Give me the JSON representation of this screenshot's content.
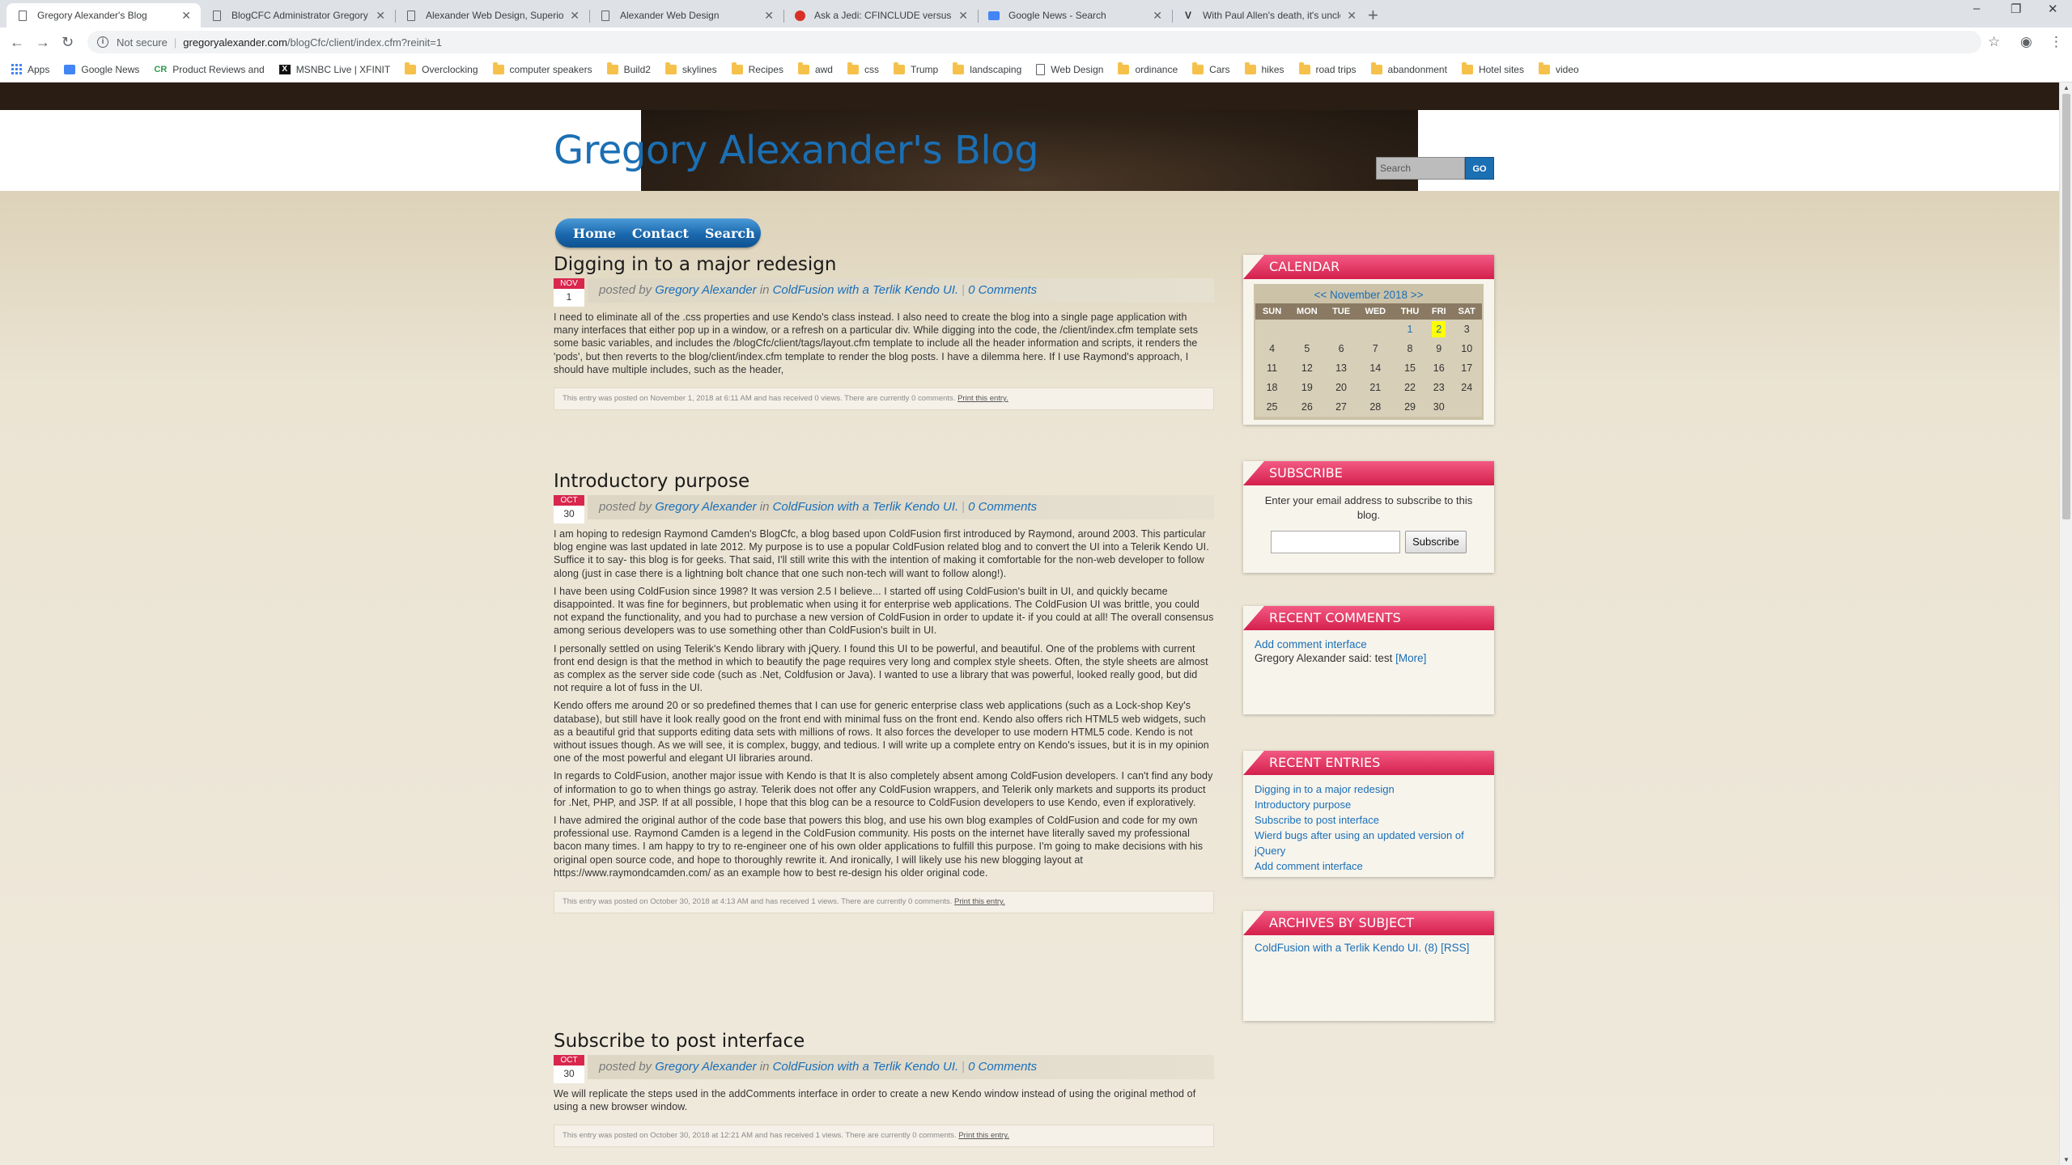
{
  "browser": {
    "tabs": [
      {
        "title": "Gregory Alexander's Blog",
        "icon": "page-icon",
        "active": true
      },
      {
        "title": "BlogCFC Administrator Gregory A",
        "icon": "page-icon"
      },
      {
        "title": "Alexander Web Design, Superior",
        "icon": "page-icon"
      },
      {
        "title": "Alexander Web Design",
        "icon": "page-icon"
      },
      {
        "title": "Ask a Jedi: CFINCLUDE versus CF",
        "icon": "red-circle-icon"
      },
      {
        "title": "Google News - Search",
        "icon": "google-news-icon"
      },
      {
        "title": "With Paul Allen's death, it's uncle",
        "icon": "verge-icon"
      }
    ],
    "new_tab": "+",
    "window_controls": {
      "minimize": "–",
      "restore": "❐",
      "close": "✕"
    },
    "nav": {
      "back": "←",
      "forward": "→",
      "reload": "↻"
    },
    "address": {
      "security": "Not secure",
      "host": "gregoryalexander.com",
      "path": "/blogCfc/client/index.cfm?reinit=1"
    },
    "toolbar_icons": {
      "star": "☆",
      "account": "◉",
      "menu": "⋮"
    },
    "bookmarks": [
      {
        "label": "Apps",
        "icon": "apps-grid-icon"
      },
      {
        "label": "Google News",
        "icon": "google-news-icon"
      },
      {
        "label": "Product Reviews and",
        "icon": "cr-icon"
      },
      {
        "label": "MSNBC Live | XFINIT",
        "icon": "x-icon"
      },
      {
        "label": "Overclocking",
        "icon": "folder-icon"
      },
      {
        "label": "computer speakers",
        "icon": "folder-icon"
      },
      {
        "label": "Build2",
        "icon": "folder-icon"
      },
      {
        "label": "skylines",
        "icon": "folder-icon"
      },
      {
        "label": "Recipes",
        "icon": "folder-icon"
      },
      {
        "label": "awd",
        "icon": "folder-icon"
      },
      {
        "label": "css",
        "icon": "folder-icon"
      },
      {
        "label": "Trump",
        "icon": "folder-icon"
      },
      {
        "label": "landscaping",
        "icon": "folder-icon"
      },
      {
        "label": "Web Design",
        "icon": "page-icon"
      },
      {
        "label": "ordinance",
        "icon": "folder-icon"
      },
      {
        "label": "Cars",
        "icon": "folder-icon"
      },
      {
        "label": "hikes",
        "icon": "folder-icon"
      },
      {
        "label": "road trips",
        "icon": "folder-icon"
      },
      {
        "label": "abandonment",
        "icon": "folder-icon"
      },
      {
        "label": "Hotel sites",
        "icon": "folder-icon"
      },
      {
        "label": "video",
        "icon": "folder-icon"
      }
    ]
  },
  "blog": {
    "title": "Gregory Alexander's Blog",
    "search_placeholder": "Search",
    "search_button": "GO",
    "menu": [
      "Home",
      "Contact",
      "Search"
    ],
    "colors": {
      "accent_blue": "#1b6fb3",
      "widget_red": "#d41f4c",
      "calendar_today": "#ffff00"
    }
  },
  "posts": [
    {
      "title": "Digging in to a major redesign",
      "month": "NOV",
      "day": "1",
      "posted_by": "posted by",
      "author": "Gregory Alexander",
      "in": "in",
      "category": "ColdFusion with a Terlik Kendo UI.",
      "comments": "0 Comments",
      "paragraphs": [
        "I need to eliminate all of the .css properties and use Kendo's class instead. I also need to create the blog into a single page application with many interfaces that either pop up in a window, or a refresh on a particular div. While digging into the code, the /client/index.cfm template sets some basic variables, and includes the /blogCfc/client/tags/layout.cfm template to include all the header information and scripts, it renders the 'pods', but then reverts to the blog/client/index.cfm template to render the blog posts. I have a dilemma here. If I use Raymond's approach, I should have multiple includes, such as the header,"
      ],
      "footer": "This entry was posted on November 1, 2018 at 6:11 AM and has received 0 views. There are currently 0 comments.",
      "print": "Print this entry."
    },
    {
      "title": "Introductory purpose",
      "month": "OCT",
      "day": "30",
      "posted_by": "posted by",
      "author": "Gregory Alexander",
      "in": "in",
      "category": "ColdFusion with a Terlik Kendo UI.",
      "comments": "0 Comments",
      "paragraphs": [
        "I am hoping to redesign Raymond Camden's BlogCfc, a blog based upon ColdFusion first introduced by Raymond, around 2003. This particular blog engine was last updated in late 2012. My purpose is to use a popular ColdFusion related blog and to convert the UI into a Telerik Kendo UI. Suffice it to say- this blog is for geeks. That said, I'll still write this with the intention of making it comfortable for the non-web developer to follow along (just in case there is a lightning bolt chance that one such non-tech will want to follow along!).",
        "I have been using ColdFusion since 1998? It was version 2.5 I believe... I started off using ColdFusion's built in UI, and quickly became disappointed. It was fine for beginners, but problematic when using it for enterprise web applications. The ColdFusion UI was brittle, you could not expand the functionality, and you had to purchase a new version of ColdFusion in order to update it- if you could at all! The overall consensus among serious developers was to use something other than ColdFusion's built in UI.",
        "I personally settled on using Telerik's Kendo library with jQuery. I found this UI to be powerful, and beautiful. One of the problems with current front end design is that the method in which to beautify the page requires very long and complex style sheets. Often, the style sheets are almost as complex as the server side code (such as .Net, Coldfusion or Java). I wanted to use a library that was powerful, looked really good, but did not require a lot of fuss in the UI.",
        "Kendo offers me around 20 or so predefined themes that I can use for generic enterprise class web applications (such as a Lock-shop Key's database), but still have it look really good on the front end with minimal fuss on the front end. Kendo also offers rich HTML5 web widgets, such as a beautiful grid that supports editing data sets with millions of rows. It also forces the developer to use modern HTML5 code. Kendo is not without issues though. As we will see, it is complex, buggy, and tedious. I will write up a complete entry on Kendo's issues, but it is in my opinion one of the most powerful and elegant UI libraries around.",
        "In regards to ColdFusion, another major issue with Kendo is that It is also completely absent among ColdFusion developers. I can't find any body of information to go to when things go astray. Telerik does not offer any ColdFusion wrappers, and Telerik only markets and supports its product for .Net, PHP, and JSP. If at all possible, I hope that this blog can be a resource to ColdFusion developers to use Kendo, even if exploratively.",
        "I have admired the original author of the code base that powers this blog, and use his own blog examples of ColdFusion and code for my own professional use. Raymond Camden is a legend in the ColdFusion community. His posts on the internet have literally saved my professional bacon many times. I am happy to try to re-engineer one of his own older applications to fulfill this purpose. I'm going to make decisions with his original open source code, and hope to thoroughly rewrite it. And ironically, I will likely use his new blogging layout at https://www.raymondcamden.com/ as an example how to best re-design his older original code."
      ],
      "footer": "This entry was posted on October 30, 2018 at 4:13 AM and has received 1 views. There are currently 0 comments.",
      "print": "Print this entry."
    },
    {
      "title": "Subscribe to post interface",
      "month": "OCT",
      "day": "30",
      "posted_by": "posted by",
      "author": "Gregory Alexander",
      "in": "in",
      "category": "ColdFusion with a Terlik Kendo UI.",
      "comments": "0 Comments",
      "paragraphs": [
        "We will replicate the steps used in the addComments interface in order to create a new Kendo window instead of using the original method of using a new browser window."
      ],
      "footer": "This entry was posted on October 30, 2018 at 12:21 AM and has received 1 views. There are currently 0 comments.",
      "print": "Print this entry."
    }
  ],
  "sidebar": {
    "calendar": {
      "title": "CALENDAR",
      "nav": "<< November 2018 >>",
      "days": [
        "SUN",
        "MON",
        "TUE",
        "WED",
        "THU",
        "FRI",
        "SAT"
      ],
      "weeks": [
        [
          "",
          "",
          "",
          "",
          "1",
          "2",
          "3"
        ],
        [
          "4",
          "5",
          "6",
          "7",
          "8",
          "9",
          "10"
        ],
        [
          "11",
          "12",
          "13",
          "14",
          "15",
          "16",
          "17"
        ],
        [
          "18",
          "19",
          "20",
          "21",
          "22",
          "23",
          "24"
        ],
        [
          "25",
          "26",
          "27",
          "28",
          "29",
          "30",
          ""
        ]
      ],
      "linked_days": [
        "1",
        "2"
      ],
      "today": "2"
    },
    "subscribe": {
      "title": "SUBSCRIBE",
      "text": "Enter your email address to subscribe to this blog.",
      "button": "Subscribe"
    },
    "recent_comments": {
      "title": "RECENT COMMENTS",
      "link": "Add comment interface",
      "text": "Gregory Alexander said: test",
      "more": "[More]"
    },
    "recent_entries": {
      "title": "RECENT ENTRIES",
      "items": [
        "Digging in to a major redesign",
        "Introductory purpose",
        "Subscribe to post interface",
        "Wierd bugs after using an updated version of jQuery",
        "Add comment interface"
      ]
    },
    "archives": {
      "title": "ARCHIVES BY SUBJECT",
      "item": "ColdFusion with a Terlik Kendo UI. (8)",
      "rss": "[RSS]"
    }
  }
}
